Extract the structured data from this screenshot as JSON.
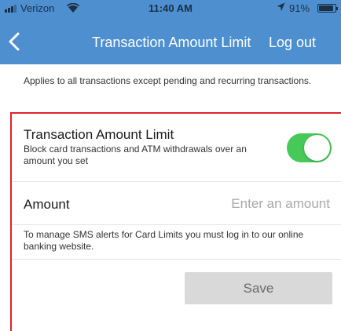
{
  "status_bar": {
    "carrier": "Verizon",
    "time": "11:40 AM",
    "battery_pct": "91%",
    "battery_level": 0.91,
    "icons": [
      "signal-icon",
      "wifi-icon",
      "location-icon",
      "battery-icon"
    ]
  },
  "nav": {
    "title": "Transaction Amount Limit",
    "logout": "Log out",
    "back_icon": "chevron-left-icon"
  },
  "intro_text": "Applies to all transactions except pending and recurring transactions.",
  "limit": {
    "title": "Transaction Amount Limit",
    "description": "Block card transactions and ATM withdrawals over an amount you set",
    "enabled": true
  },
  "amount": {
    "label": "Amount",
    "value": "",
    "placeholder": "Enter an amount"
  },
  "sms_note": "To manage SMS alerts for Card Limits you must log in to our online banking website.",
  "save_label": "Save",
  "colors": {
    "header": "#4d8fcf",
    "toggle_on": "#47c95a",
    "highlight_border": "#e2222a",
    "save_disabled": "#d9d9d9"
  }
}
